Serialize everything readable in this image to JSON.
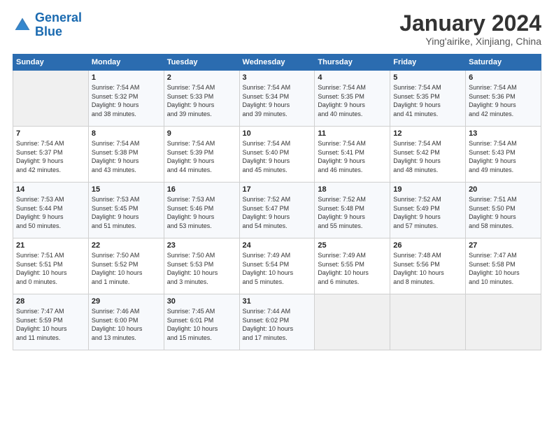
{
  "logo": {
    "line1": "General",
    "line2": "Blue"
  },
  "title": "January 2024",
  "subtitle": "Ying'airike, Xinjiang, China",
  "days_header": [
    "Sunday",
    "Monday",
    "Tuesday",
    "Wednesday",
    "Thursday",
    "Friday",
    "Saturday"
  ],
  "weeks": [
    [
      {
        "day": "",
        "info": ""
      },
      {
        "day": "1",
        "info": "Sunrise: 7:54 AM\nSunset: 5:32 PM\nDaylight: 9 hours\nand 38 minutes."
      },
      {
        "day": "2",
        "info": "Sunrise: 7:54 AM\nSunset: 5:33 PM\nDaylight: 9 hours\nand 39 minutes."
      },
      {
        "day": "3",
        "info": "Sunrise: 7:54 AM\nSunset: 5:34 PM\nDaylight: 9 hours\nand 39 minutes."
      },
      {
        "day": "4",
        "info": "Sunrise: 7:54 AM\nSunset: 5:35 PM\nDaylight: 9 hours\nand 40 minutes."
      },
      {
        "day": "5",
        "info": "Sunrise: 7:54 AM\nSunset: 5:35 PM\nDaylight: 9 hours\nand 41 minutes."
      },
      {
        "day": "6",
        "info": "Sunrise: 7:54 AM\nSunset: 5:36 PM\nDaylight: 9 hours\nand 42 minutes."
      }
    ],
    [
      {
        "day": "7",
        "info": "Sunrise: 7:54 AM\nSunset: 5:37 PM\nDaylight: 9 hours\nand 42 minutes."
      },
      {
        "day": "8",
        "info": "Sunrise: 7:54 AM\nSunset: 5:38 PM\nDaylight: 9 hours\nand 43 minutes."
      },
      {
        "day": "9",
        "info": "Sunrise: 7:54 AM\nSunset: 5:39 PM\nDaylight: 9 hours\nand 44 minutes."
      },
      {
        "day": "10",
        "info": "Sunrise: 7:54 AM\nSunset: 5:40 PM\nDaylight: 9 hours\nand 45 minutes."
      },
      {
        "day": "11",
        "info": "Sunrise: 7:54 AM\nSunset: 5:41 PM\nDaylight: 9 hours\nand 46 minutes."
      },
      {
        "day": "12",
        "info": "Sunrise: 7:54 AM\nSunset: 5:42 PM\nDaylight: 9 hours\nand 48 minutes."
      },
      {
        "day": "13",
        "info": "Sunrise: 7:54 AM\nSunset: 5:43 PM\nDaylight: 9 hours\nand 49 minutes."
      }
    ],
    [
      {
        "day": "14",
        "info": "Sunrise: 7:53 AM\nSunset: 5:44 PM\nDaylight: 9 hours\nand 50 minutes."
      },
      {
        "day": "15",
        "info": "Sunrise: 7:53 AM\nSunset: 5:45 PM\nDaylight: 9 hours\nand 51 minutes."
      },
      {
        "day": "16",
        "info": "Sunrise: 7:53 AM\nSunset: 5:46 PM\nDaylight: 9 hours\nand 53 minutes."
      },
      {
        "day": "17",
        "info": "Sunrise: 7:52 AM\nSunset: 5:47 PM\nDaylight: 9 hours\nand 54 minutes."
      },
      {
        "day": "18",
        "info": "Sunrise: 7:52 AM\nSunset: 5:48 PM\nDaylight: 9 hours\nand 55 minutes."
      },
      {
        "day": "19",
        "info": "Sunrise: 7:52 AM\nSunset: 5:49 PM\nDaylight: 9 hours\nand 57 minutes."
      },
      {
        "day": "20",
        "info": "Sunrise: 7:51 AM\nSunset: 5:50 PM\nDaylight: 9 hours\nand 58 minutes."
      }
    ],
    [
      {
        "day": "21",
        "info": "Sunrise: 7:51 AM\nSunset: 5:51 PM\nDaylight: 10 hours\nand 0 minutes."
      },
      {
        "day": "22",
        "info": "Sunrise: 7:50 AM\nSunset: 5:52 PM\nDaylight: 10 hours\nand 1 minute."
      },
      {
        "day": "23",
        "info": "Sunrise: 7:50 AM\nSunset: 5:53 PM\nDaylight: 10 hours\nand 3 minutes."
      },
      {
        "day": "24",
        "info": "Sunrise: 7:49 AM\nSunset: 5:54 PM\nDaylight: 10 hours\nand 5 minutes."
      },
      {
        "day": "25",
        "info": "Sunrise: 7:49 AM\nSunset: 5:55 PM\nDaylight: 10 hours\nand 6 minutes."
      },
      {
        "day": "26",
        "info": "Sunrise: 7:48 AM\nSunset: 5:56 PM\nDaylight: 10 hours\nand 8 minutes."
      },
      {
        "day": "27",
        "info": "Sunrise: 7:47 AM\nSunset: 5:58 PM\nDaylight: 10 hours\nand 10 minutes."
      }
    ],
    [
      {
        "day": "28",
        "info": "Sunrise: 7:47 AM\nSunset: 5:59 PM\nDaylight: 10 hours\nand 11 minutes."
      },
      {
        "day": "29",
        "info": "Sunrise: 7:46 AM\nSunset: 6:00 PM\nDaylight: 10 hours\nand 13 minutes."
      },
      {
        "day": "30",
        "info": "Sunrise: 7:45 AM\nSunset: 6:01 PM\nDaylight: 10 hours\nand 15 minutes."
      },
      {
        "day": "31",
        "info": "Sunrise: 7:44 AM\nSunset: 6:02 PM\nDaylight: 10 hours\nand 17 minutes."
      },
      {
        "day": "",
        "info": ""
      },
      {
        "day": "",
        "info": ""
      },
      {
        "day": "",
        "info": ""
      }
    ]
  ]
}
